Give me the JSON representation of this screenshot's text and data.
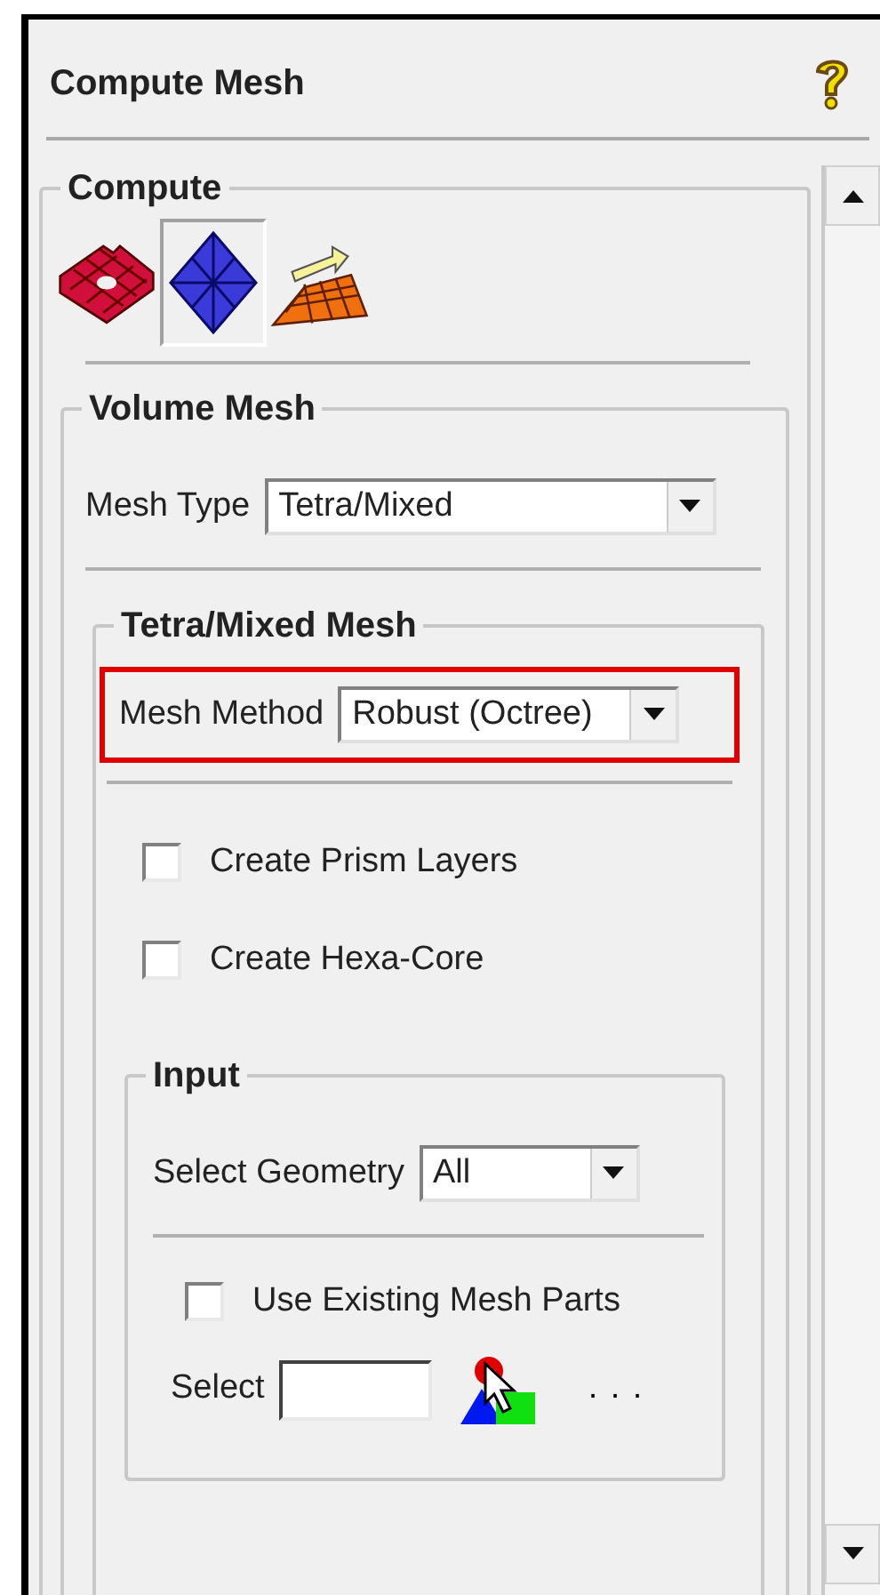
{
  "title": "Compute Mesh",
  "compute": {
    "legend": "Compute",
    "modes": [
      {
        "kind": "shell",
        "selected": false
      },
      {
        "kind": "volume",
        "selected": true
      },
      {
        "kind": "prism",
        "selected": false
      }
    ]
  },
  "volume_mesh": {
    "legend": "Volume Mesh",
    "mesh_type": {
      "label": "Mesh Type",
      "value": "Tetra/Mixed"
    },
    "tetra_mixed": {
      "legend": "Tetra/Mixed Mesh",
      "mesh_method": {
        "label": "Mesh Method",
        "value": "Robust (Octree)",
        "highlighted": true
      },
      "options": [
        {
          "label": "Create Prism Layers",
          "checked": false
        },
        {
          "label": "Create Hexa-Core",
          "checked": false
        }
      ],
      "input": {
        "legend": "Input",
        "select_geometry": {
          "label": "Select Geometry",
          "value": "All"
        },
        "use_existing": {
          "label": "Use Existing Mesh Parts",
          "checked": false
        },
        "select": {
          "label": "Select",
          "more": ". . ."
        }
      }
    }
  }
}
